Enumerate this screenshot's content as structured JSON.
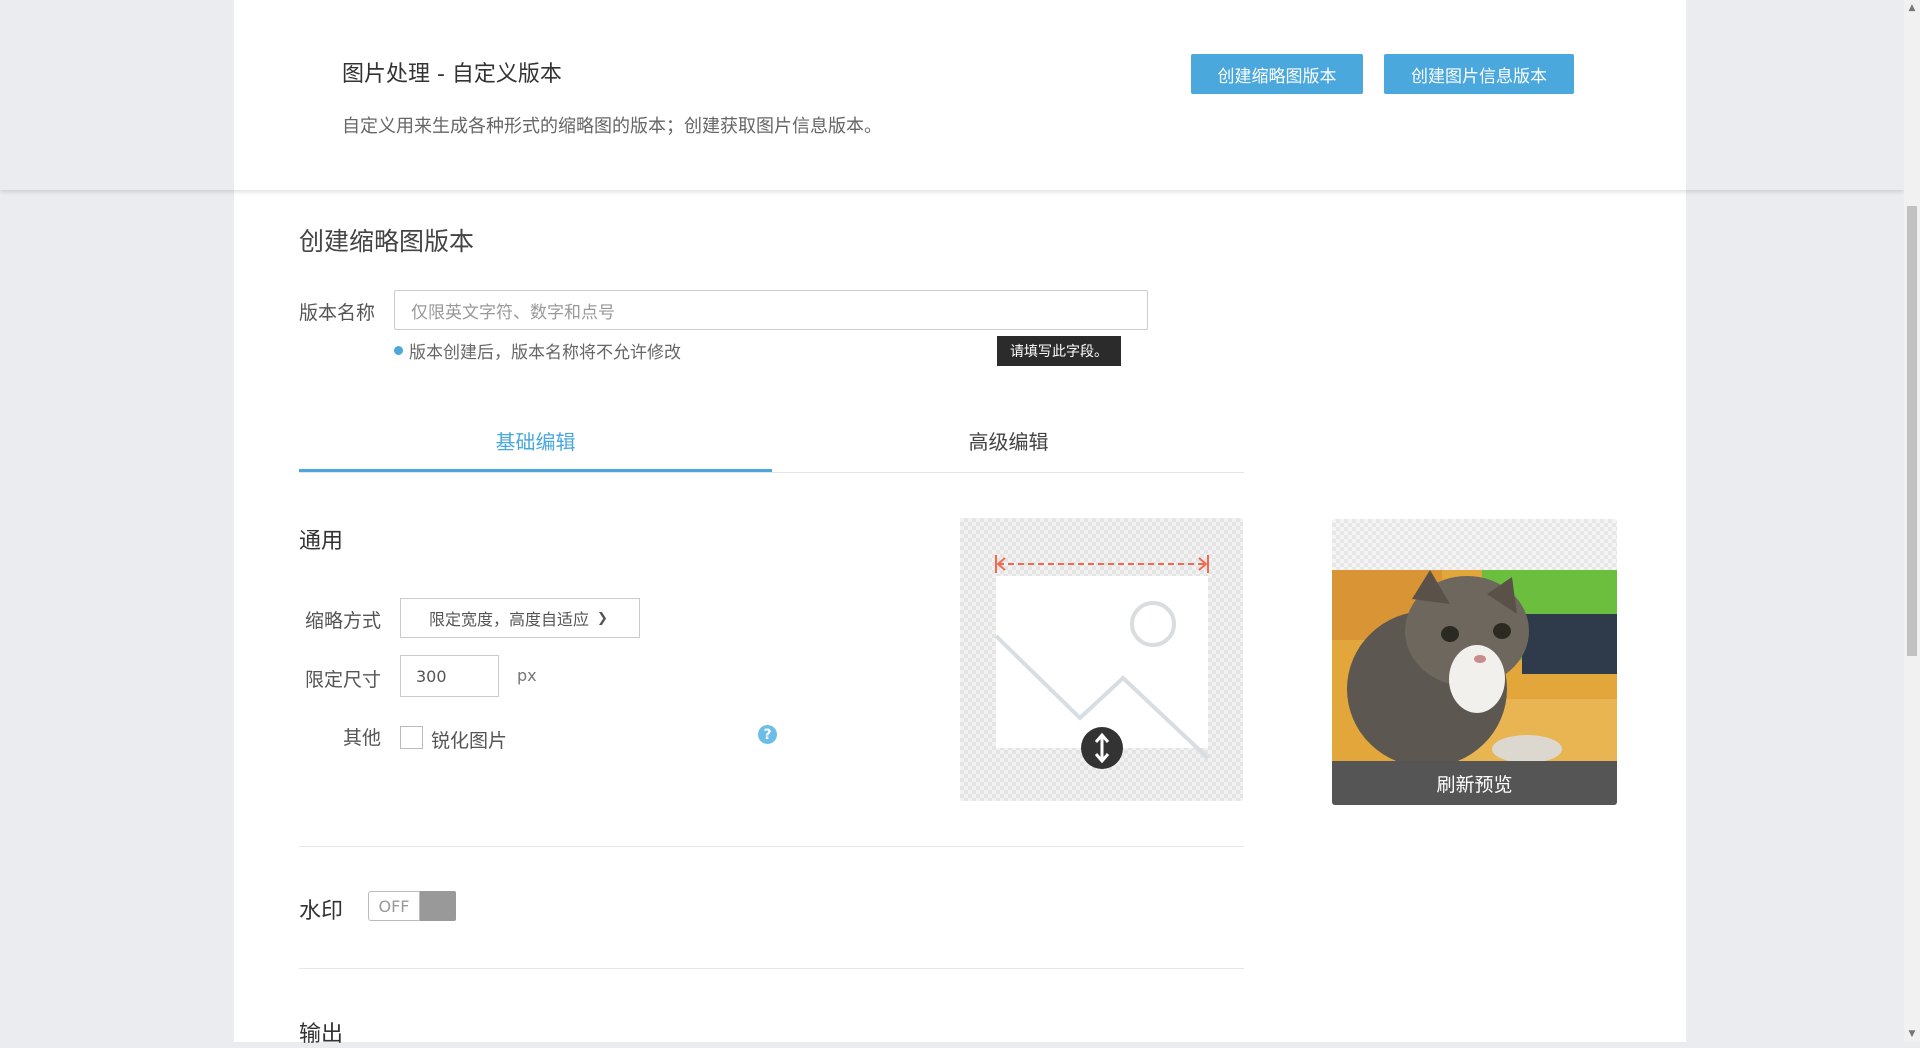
{
  "header": {
    "title": "图片处理 - 自定义版本",
    "description": "自定义用来生成各种形式的缩略图的版本；创建获取图片信息版本。",
    "btn_thumbnail": "创建缩略图版本",
    "btn_info": "创建图片信息版本"
  },
  "form": {
    "section_title": "创建缩略图版本",
    "name_label": "版本名称",
    "name_placeholder": "仅限英文字符、数字和点号",
    "name_hint": "版本创建后，版本名称将不允许修改",
    "tooltip": "请填写此字段。"
  },
  "tabs": [
    {
      "label": "基础编辑",
      "active": true
    },
    {
      "label": "高级编辑",
      "active": false
    }
  ],
  "general": {
    "title": "通用",
    "mode_label": "缩略方式",
    "mode_value": "限定宽度，高度自适应",
    "size_label": "限定尺寸",
    "size_value": "300",
    "size_unit": "px",
    "other_label": "其他",
    "sharpen_label": "锐化图片",
    "sharpen_checked": false,
    "help": "?"
  },
  "watermark": {
    "title": "水印",
    "toggle_label": "OFF",
    "enabled": false
  },
  "output": {
    "title": "输出"
  },
  "preview": {
    "refresh_label": "刷新预览"
  },
  "colors": {
    "accent": "#4aa8dd",
    "arrow": "#f06a4f"
  }
}
